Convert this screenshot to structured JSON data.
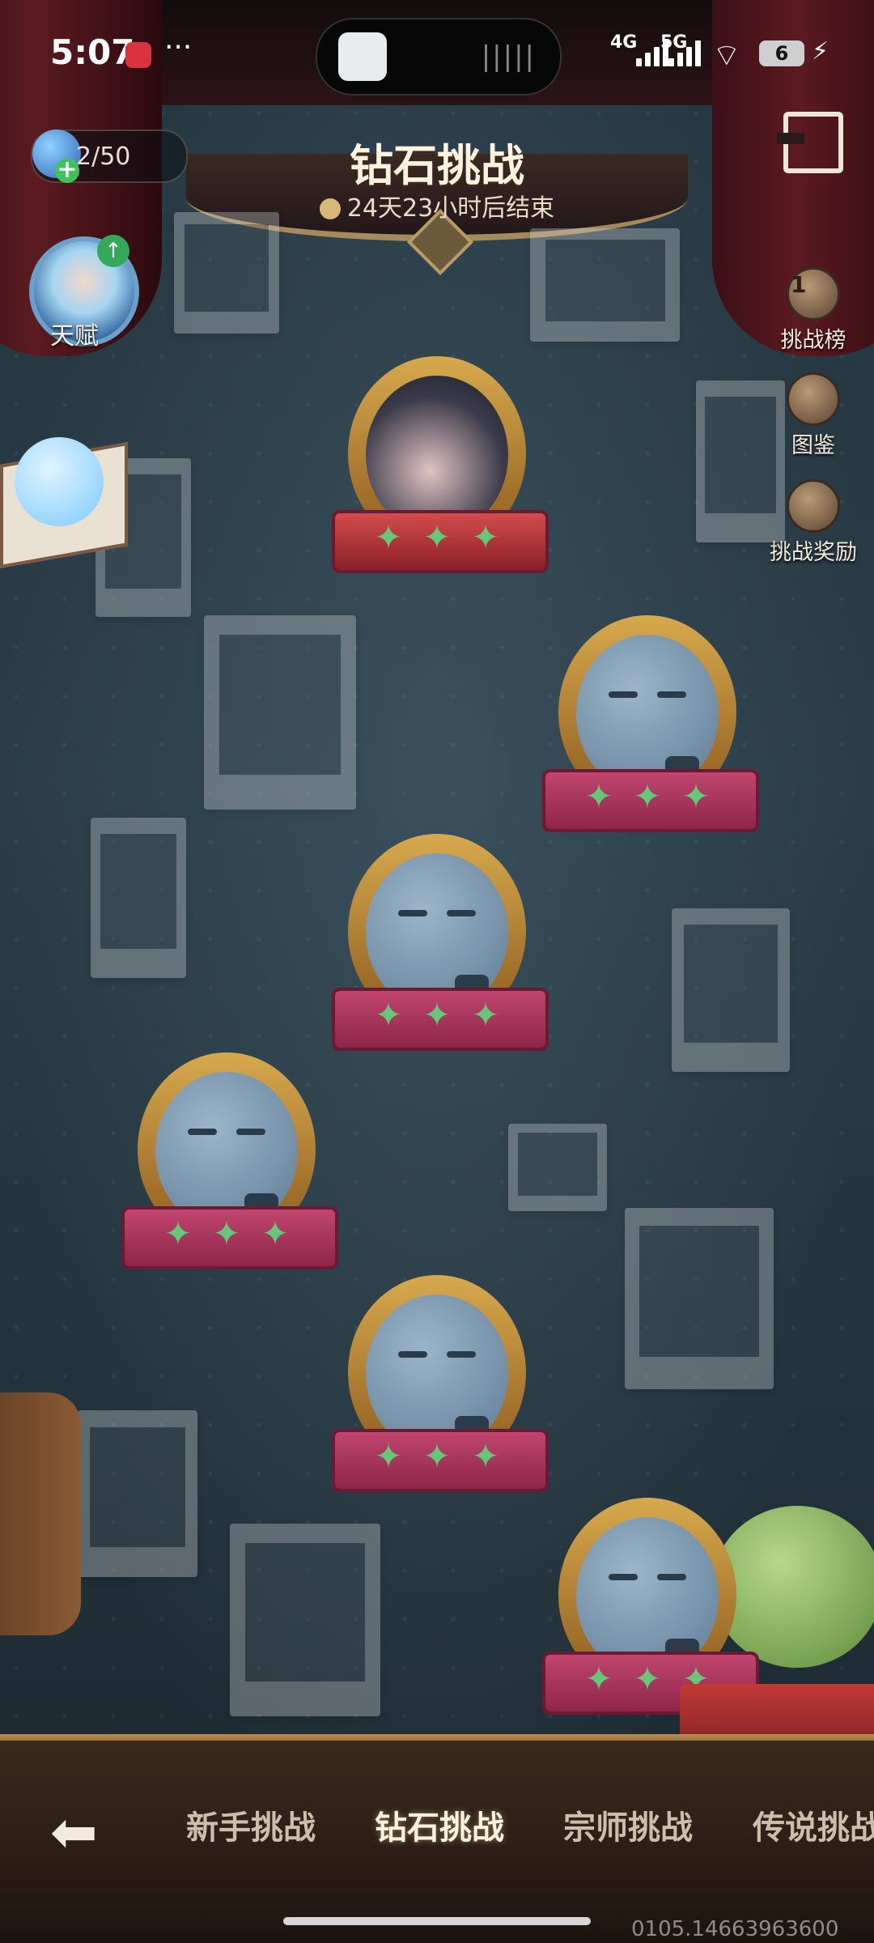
{
  "status_bar": {
    "time": "5:07",
    "more": "···",
    "network_1": "4G",
    "network_2": "5G",
    "battery": "6"
  },
  "hud": {
    "energy": "2/50",
    "title": "钻石挑战",
    "timer": "24天23小时后结束",
    "talent_label": "天赋"
  },
  "side_menu": {
    "rank_label": "挑战榜",
    "rank_badge": "1",
    "codex_label": "图鉴",
    "reward_label": "挑战奖励"
  },
  "levels": [
    {
      "stars": 3,
      "state": "boss"
    },
    {
      "stars": 3,
      "state": "locked"
    },
    {
      "stars": 3,
      "state": "locked"
    },
    {
      "stars": 3,
      "state": "locked"
    },
    {
      "stars": 3,
      "state": "locked"
    },
    {
      "stars": 3,
      "state": "locked"
    }
  ],
  "tabs": [
    "新手挑战",
    "钻石挑战",
    "宗师挑战",
    "传说挑战"
  ],
  "active_tab": "钻石挑战",
  "build_id": "0105.14663963600",
  "colors": {
    "accent": "#fff3df",
    "star": "#66c67a",
    "ribbon": "#b23c63"
  }
}
